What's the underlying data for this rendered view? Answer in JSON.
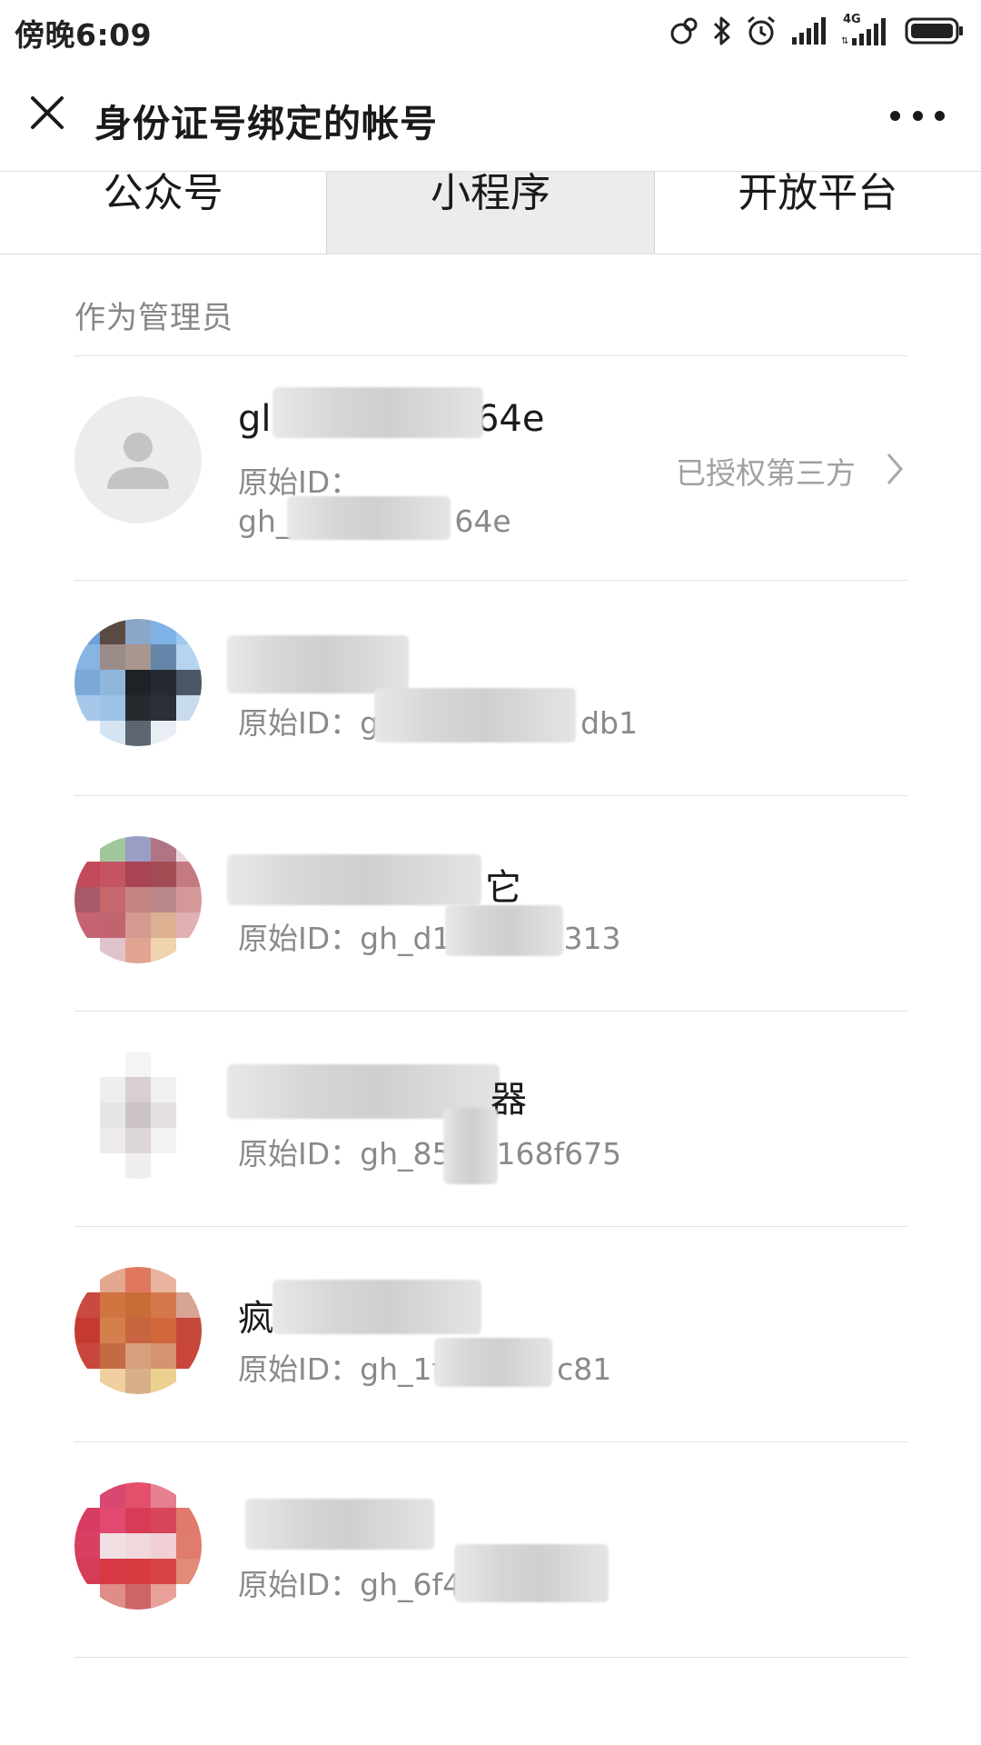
{
  "status_bar": {
    "time": "傍晚6:09",
    "network_type": "4G",
    "icons": [
      "hotspot-icon",
      "bluetooth-icon",
      "alarm-icon",
      "signal-icon",
      "signal-4g-icon",
      "battery-icon"
    ]
  },
  "header": {
    "title": "身份证号绑定的帐号",
    "close_icon": "close-icon",
    "more_icon": "more-icon"
  },
  "tabs": [
    {
      "label": "公众号",
      "active": false
    },
    {
      "label": "小程序",
      "active": true
    },
    {
      "label": "开放平台",
      "active": false
    }
  ],
  "section_label": "作为管理员",
  "accounts": [
    {
      "name_prefix": "gl",
      "name_suffix": "364e",
      "id_label": "原始ID：",
      "id_prefix": "gh_",
      "id_suffix": "64e",
      "status": "已授权第三方",
      "avatar": "default-avatar-icon"
    },
    {
      "name_prefix": "",
      "name_suffix": "",
      "id_label": "原始ID：",
      "id_prefix": "g",
      "id_suffix": "db1",
      "avatar": "blurred-avatar"
    },
    {
      "name_prefix": "",
      "name_suffix": "它",
      "id_label": "原始ID：",
      "id_prefix": "gh_d1",
      "id_suffix": "313",
      "avatar": "blurred-avatar"
    },
    {
      "name_prefix": "",
      "name_suffix": "器",
      "id_label": "原始ID：",
      "id_prefix": "gh_85",
      "id_suffix": "168f675",
      "avatar": "blurred-avatar"
    },
    {
      "name_prefix": "疯",
      "name_suffix": "",
      "id_label": "原始ID：",
      "id_prefix": "gh_1f",
      "id_suffix": "c81",
      "avatar": "blurred-avatar"
    },
    {
      "name_prefix": "",
      "name_suffix": "",
      "id_label": "原始ID：",
      "id_prefix": "gh_6f4",
      "id_suffix": "",
      "avatar": "blurred-avatar"
    }
  ],
  "colors": {
    "tab_active_bg": "#ececec",
    "secondary_text": "#8a8a8a",
    "divider": "#e2e2e2"
  }
}
